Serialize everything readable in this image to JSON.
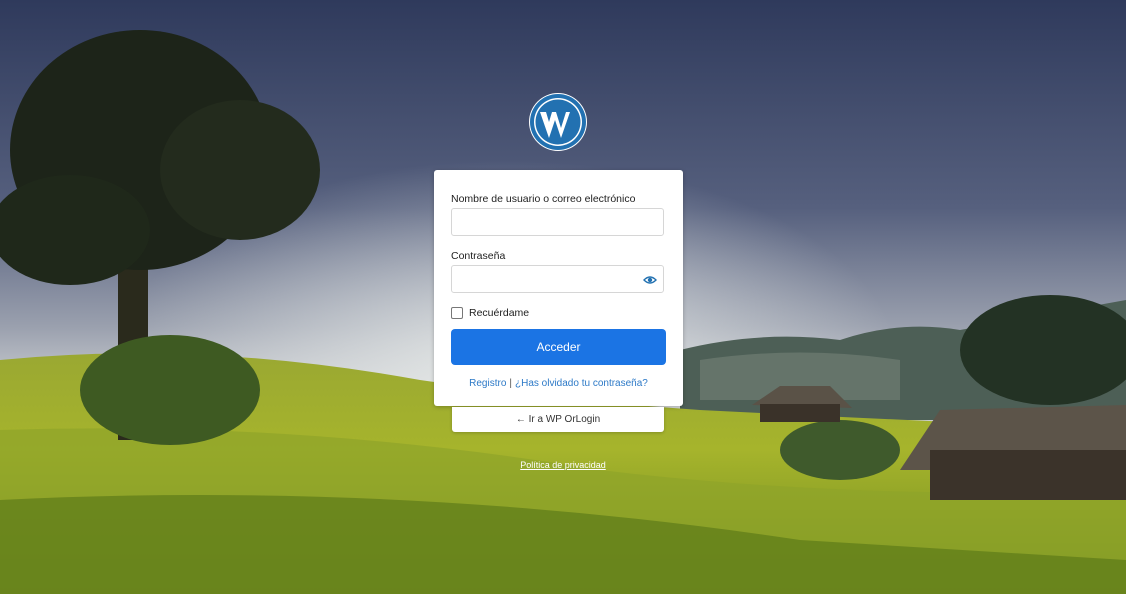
{
  "form": {
    "username_label": "Nombre de usuario o correo electrónico",
    "username_value": "",
    "password_label": "Contraseña",
    "password_value": "",
    "remember_label": "Recuérdame",
    "remember_checked": false,
    "submit_label": "Acceder"
  },
  "links": {
    "register": "Registro",
    "separator": "|",
    "forgot_password": "¿Has olvidado tu contraseña?"
  },
  "back_link": "← Ir a WP OrLogin",
  "privacy_link": "Política de privacidad",
  "colors": {
    "primary_button": "#1b74e4",
    "link": "#2c79c7",
    "logo": "#2271b1"
  },
  "icons": {
    "logo": "wordpress-logo",
    "password_toggle": "eye-icon"
  }
}
